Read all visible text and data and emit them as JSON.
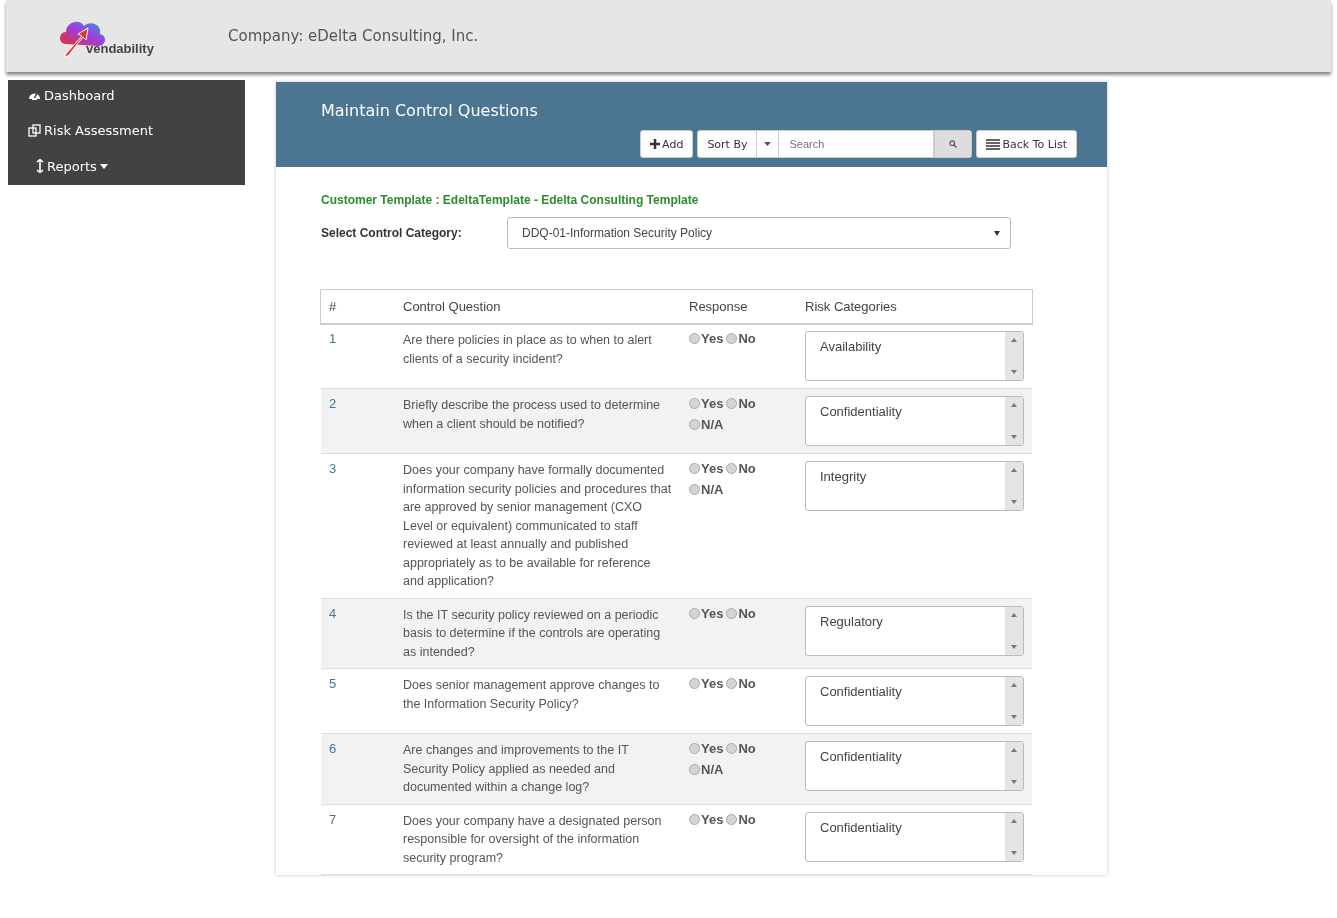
{
  "header": {
    "logo_text": "vendability",
    "company": "Company: eDelta Consulting, Inc."
  },
  "sidebar": {
    "items": [
      {
        "label": "Dashboard",
        "has_caret": false
      },
      {
        "label": "Risk Assessment",
        "has_caret": false
      },
      {
        "label": "Reports",
        "has_caret": true
      }
    ]
  },
  "panel": {
    "title": "Maintain Control Questions",
    "toolbar": {
      "add": "Add",
      "sort": "Sort By",
      "search_placeholder": "Search",
      "back": "Back To List"
    },
    "template": "Customer Template : EdeltaTemplate - Edelta Consulting Template",
    "category_label": "Select Control Category:",
    "category_value": "DDQ-01-Information Security Policy",
    "table": {
      "columns": [
        "#",
        "Control Question",
        "Response",
        "Risk Categories"
      ],
      "rows": [
        {
          "number": "1",
          "question": "Are there policies in place as to when to alert clients of a security incident?",
          "options": [
            {
              "label": "Yes",
              "selected": false
            },
            {
              "label": "No",
              "selected": false
            }
          ],
          "risk_category": "Availability"
        },
        {
          "number": "2",
          "question": "Briefly describe the process used to determine when a client should be notified?",
          "options": [
            {
              "label": "Yes",
              "selected": false
            },
            {
              "label": "No",
              "selected": false
            },
            {
              "label": "N/A",
              "selected": false
            }
          ],
          "risk_category": "Confidentiality"
        },
        {
          "number": "3",
          "question": "Does your company have formally documented information security policies and procedures that are approved by senior management (CXO Level or equivalent) communicated to staff reviewed at least annually and published appropriately as to be available for reference and application?",
          "options": [
            {
              "label": "Yes",
              "selected": false
            },
            {
              "label": "No",
              "selected": false
            },
            {
              "label": "N/A",
              "selected": false
            }
          ],
          "risk_category": "Integrity"
        },
        {
          "number": "4",
          "question": "Is the IT security policy reviewed on a periodic basis to determine if the controls are operating as intended?",
          "options": [
            {
              "label": "Yes",
              "selected": false
            },
            {
              "label": "No",
              "selected": false
            }
          ],
          "risk_category": "Regulatory"
        },
        {
          "number": "5",
          "question": "Does senior management approve changes to the Information Security Policy?",
          "options": [
            {
              "label": "Yes",
              "selected": false
            },
            {
              "label": "No",
              "selected": false
            }
          ],
          "risk_category": "Confidentiality"
        },
        {
          "number": "6",
          "question": "Are changes and improvements to the IT Security Policy applied as needed and documented within a change log?",
          "options": [
            {
              "label": "Yes",
              "selected": false
            },
            {
              "label": "No",
              "selected": false
            },
            {
              "label": "N/A",
              "selected": false
            }
          ],
          "risk_category": "Confidentiality"
        },
        {
          "number": "7",
          "question": "Does your company have a designated person responsible for oversight of the information security program?",
          "options": [
            {
              "label": "Yes",
              "selected": false
            },
            {
              "label": "No",
              "selected": false
            }
          ],
          "risk_category": "Confidentiality"
        }
      ]
    }
  }
}
